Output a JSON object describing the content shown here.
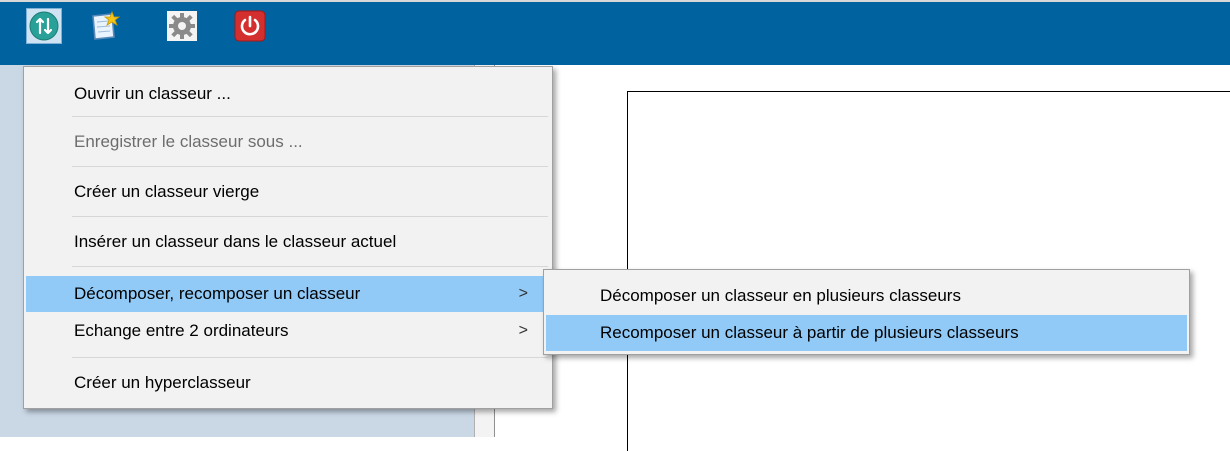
{
  "toolbar": {
    "buttons": [
      {
        "name": "sync-button",
        "icon": "sync-arrows-icon",
        "color": "#2aa198"
      },
      {
        "name": "new-notebook-button",
        "icon": "new-notebook-star-icon",
        "color": "#f2c94c"
      },
      {
        "name": "settings-button",
        "icon": "gear-icon",
        "color": "#9a9a9a"
      },
      {
        "name": "power-button",
        "icon": "power-icon",
        "color": "#d32f2f"
      }
    ],
    "background": "#0063a0"
  },
  "menu": {
    "items": [
      {
        "label": "Ouvrir un classeur ...",
        "enabled": true
      },
      {
        "label": "Enregistrer le classeur sous ...",
        "enabled": false
      },
      {
        "label": "Créer un classeur vierge",
        "enabled": true
      },
      {
        "label": "Insérer un classeur dans le classeur actuel",
        "enabled": true
      },
      {
        "label": "Décomposer, recomposer un classeur",
        "enabled": true,
        "submenu": true,
        "highlighted": true
      },
      {
        "label": "Echange entre 2 ordinateurs",
        "enabled": true,
        "submenu": true
      },
      {
        "label": "Créer un hyperclasseur",
        "enabled": true
      }
    ],
    "submenu_arrow": ">"
  },
  "submenu": {
    "items": [
      {
        "label": "Décomposer un classeur en plusieurs classeurs"
      },
      {
        "label": "Recomposer un classeur à partir de plusieurs classeurs",
        "highlighted": true
      }
    ]
  },
  "colors": {
    "highlight": "#91c9f7",
    "menu_bg": "#f2f2f2",
    "left_panel": "#cad8e6"
  }
}
